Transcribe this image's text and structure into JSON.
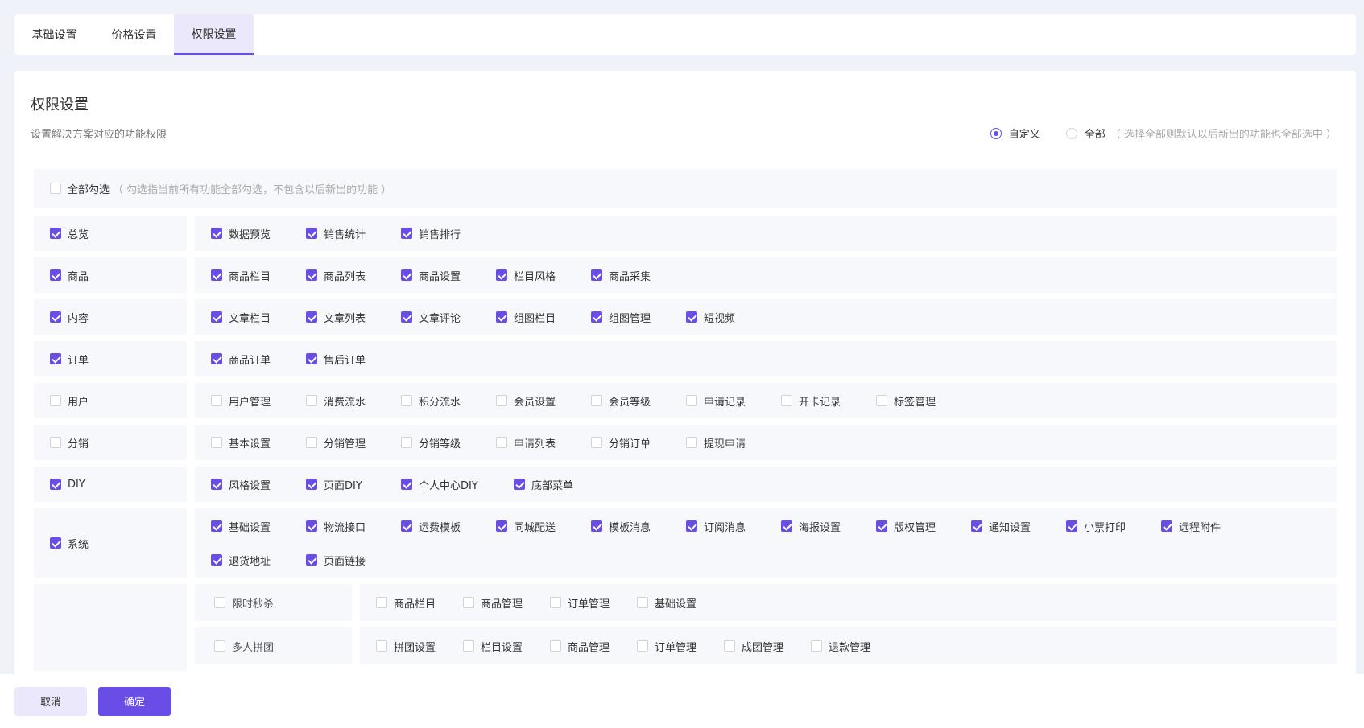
{
  "tabs": [
    {
      "label": "基础设置",
      "active": false
    },
    {
      "label": "价格设置",
      "active": false
    },
    {
      "label": "权限设置",
      "active": true
    }
  ],
  "section": {
    "title": "权限设置",
    "subtitle": "设置解决方案对应的功能权限",
    "mode_options": [
      {
        "label": "自定义",
        "selected": true,
        "hint": ""
      },
      {
        "label": "全部",
        "selected": false,
        "hint": "（ 选择全部则默认以后新出的功能也全部选中 ）"
      }
    ]
  },
  "select_all": {
    "label": "全部勾选",
    "hint": "（ 勾选指当前所有功能全部勾选，不包含以后新出的功能 ）",
    "checked": false
  },
  "modules": [
    {
      "name": "总览",
      "checked": true,
      "items": [
        {
          "label": "数据预览",
          "checked": true
        },
        {
          "label": "销售统计",
          "checked": true
        },
        {
          "label": "销售排行",
          "checked": true
        }
      ]
    },
    {
      "name": "商品",
      "checked": true,
      "items": [
        {
          "label": "商品栏目",
          "checked": true
        },
        {
          "label": "商品列表",
          "checked": true
        },
        {
          "label": "商品设置",
          "checked": true
        },
        {
          "label": "栏目风格",
          "checked": true
        },
        {
          "label": "商品采集",
          "checked": true
        }
      ]
    },
    {
      "name": "内容",
      "checked": true,
      "items": [
        {
          "label": "文章栏目",
          "checked": true
        },
        {
          "label": "文章列表",
          "checked": true
        },
        {
          "label": "文章评论",
          "checked": true
        },
        {
          "label": "组图栏目",
          "checked": true
        },
        {
          "label": "组图管理",
          "checked": true
        },
        {
          "label": "短视频",
          "checked": true
        }
      ]
    },
    {
      "name": "订单",
      "checked": true,
      "items": [
        {
          "label": "商品订单",
          "checked": true
        },
        {
          "label": "售后订单",
          "checked": true
        }
      ]
    },
    {
      "name": "用户",
      "checked": false,
      "items": [
        {
          "label": "用户管理",
          "checked": false
        },
        {
          "label": "消费流水",
          "checked": false
        },
        {
          "label": "积分流水",
          "checked": false
        },
        {
          "label": "会员设置",
          "checked": false
        },
        {
          "label": "会员等级",
          "checked": false
        },
        {
          "label": "申请记录",
          "checked": false
        },
        {
          "label": "开卡记录",
          "checked": false
        },
        {
          "label": "标签管理",
          "checked": false
        }
      ]
    },
    {
      "name": "分销",
      "checked": false,
      "items": [
        {
          "label": "基本设置",
          "checked": false
        },
        {
          "label": "分销管理",
          "checked": false
        },
        {
          "label": "分销等级",
          "checked": false
        },
        {
          "label": "申请列表",
          "checked": false
        },
        {
          "label": "分销订单",
          "checked": false
        },
        {
          "label": "提现申请",
          "checked": false
        }
      ]
    },
    {
      "name": "DIY",
      "checked": true,
      "items": [
        {
          "label": "风格设置",
          "checked": true
        },
        {
          "label": "页面DIY",
          "checked": true
        },
        {
          "label": "个人中心DIY",
          "checked": true
        },
        {
          "label": "底部菜单",
          "checked": true
        }
      ]
    },
    {
      "name": "系统",
      "checked": true,
      "items": [
        {
          "label": "基础设置",
          "checked": true
        },
        {
          "label": "物流接口",
          "checked": true
        },
        {
          "label": "运费模板",
          "checked": true
        },
        {
          "label": "同城配送",
          "checked": true
        },
        {
          "label": "模板消息",
          "checked": true
        },
        {
          "label": "订阅消息",
          "checked": true
        },
        {
          "label": "海报设置",
          "checked": true
        },
        {
          "label": "版权管理",
          "checked": true
        },
        {
          "label": "通知设置",
          "checked": true
        },
        {
          "label": "小票打印",
          "checked": true
        },
        {
          "label": "远程附件",
          "checked": true
        },
        {
          "label": "退货地址",
          "checked": true
        },
        {
          "label": "页面链接",
          "checked": true
        }
      ]
    }
  ],
  "sub_modules": [
    {
      "name": "限时秒杀",
      "checked": false,
      "items": [
        {
          "label": "商品栏目",
          "checked": false
        },
        {
          "label": "商品管理",
          "checked": false
        },
        {
          "label": "订单管理",
          "checked": false
        },
        {
          "label": "基础设置",
          "checked": false
        }
      ]
    },
    {
      "name": "多人拼团",
      "checked": false,
      "items": [
        {
          "label": "拼团设置",
          "checked": false
        },
        {
          "label": "栏目设置",
          "checked": false
        },
        {
          "label": "商品管理",
          "checked": false
        },
        {
          "label": "订单管理",
          "checked": false
        },
        {
          "label": "成团管理",
          "checked": false
        },
        {
          "label": "退款管理",
          "checked": false
        }
      ]
    }
  ],
  "footer": {
    "cancel_label": "取消",
    "confirm_label": "确定"
  },
  "colors": {
    "accent": "#6a4de6",
    "accent_light": "#ece8fb",
    "page_bg": "#f0f2fa"
  }
}
